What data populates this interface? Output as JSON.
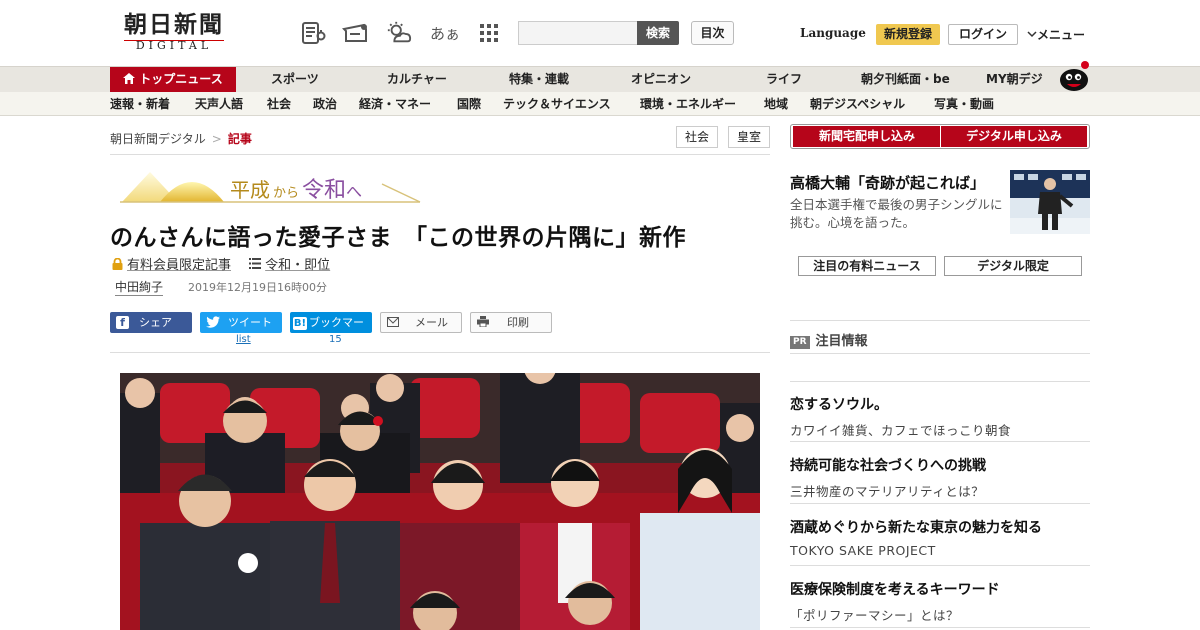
{
  "header": {
    "logo_jp": "朝日新聞",
    "logo_en": "DIGITAL",
    "search_button": "検索",
    "mokuji_button": "目次",
    "language": "Language",
    "register": "新規登録",
    "login": "ログイン",
    "menu": "メニュー",
    "font_size_icon_label": "あぁ",
    "search_placeholder": ""
  },
  "nav_primary": {
    "top_news": "トップニュース",
    "items": [
      "スポーツ",
      "カルチャー",
      "特集・連載",
      "オピニオン",
      "ライフ",
      "朝夕刊紙面・be",
      "MY朝デジ"
    ]
  },
  "nav_secondary": {
    "items": [
      "速報・新着",
      "天声人語",
      "社会",
      "政治",
      "経済・マネー",
      "国際",
      "テック＆サイエンス",
      "環境・エネルギー",
      "地域",
      "朝デジスペシャル",
      "写真・動画"
    ]
  },
  "breadcrumb": {
    "home": "朝日新聞デジタル",
    "separator": ">",
    "current": "記事"
  },
  "tags": [
    "社会",
    "皇室"
  ],
  "article": {
    "banner": {
      "from": "平成",
      "kara": "から",
      "to": "令和",
      "he": "へ"
    },
    "headline": "のんさんに語った愛子さま　「この世界の片隅に」新作",
    "members_only": "有料会員限定記事",
    "category": "令和・即位",
    "author": "中田絢子",
    "date": "2019年12月19日16時00分"
  },
  "share": {
    "facebook": "シェア",
    "twitter": "ツイート",
    "hatena": "ブックマーク",
    "mail": "メール",
    "print": "印刷",
    "twitter_count": "list",
    "hatena_count": "15"
  },
  "sidebar": {
    "subscribe_paper": "新聞宅配申し込み",
    "subscribe_digital": "デジタル申し込み",
    "feature": {
      "title": "高橋大輔「奇跡が起これば」",
      "desc": "全日本選手権で最後の男子シングルに挑む。心境を語った。"
    },
    "tab_premium": "注目の有料ニュース",
    "tab_digital": "デジタル限定",
    "pr_badge": "PR",
    "pr_heading": "注目情報",
    "pr_items": [
      {
        "title": "恋するソウル。",
        "desc": "カワイイ雑貨、カフェでほっこり朝食"
      },
      {
        "title": "持続可能な社会づくりへの挑戦",
        "desc": "三井物産のマテリアリティとは？"
      },
      {
        "title": "酒蔵めぐりから新たな東京の魅力を知る",
        "desc": "TOKYO SAKE PROJECT"
      },
      {
        "title": "医療保険制度を考えるキーワード",
        "desc": "「ポリファーマシー」とは？"
      }
    ]
  },
  "colors": {
    "brand_red": "#b6051a",
    "register_yellow": "#f0c850",
    "nav_bg": "#e8e6e0",
    "facebook": "#3b5998",
    "twitter": "#1da1f2",
    "hatena": "#008fde"
  }
}
